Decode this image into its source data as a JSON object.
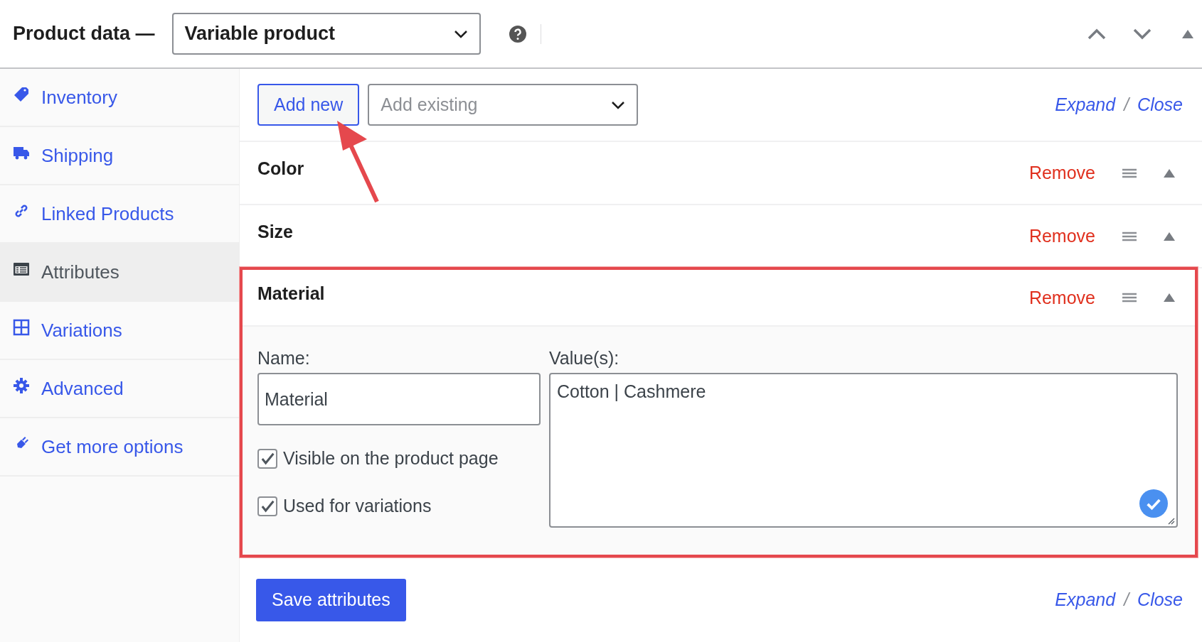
{
  "header": {
    "title": "Product data —",
    "product_type": "Variable product"
  },
  "sidebar": {
    "items": [
      {
        "label": "Inventory",
        "selected": false
      },
      {
        "label": "Shipping",
        "selected": false
      },
      {
        "label": "Linked Products",
        "selected": false
      },
      {
        "label": "Attributes",
        "selected": true
      },
      {
        "label": "Variations",
        "selected": false
      },
      {
        "label": "Advanced",
        "selected": false
      },
      {
        "label": "Get more options",
        "selected": false
      }
    ]
  },
  "toolbar": {
    "add_new": "Add new",
    "add_existing": {
      "placeholder": "Add existing"
    },
    "expand": "Expand",
    "separator": "/",
    "close": "Close"
  },
  "attributes": [
    {
      "name": "Color",
      "remove": "Remove",
      "expanded": false,
      "highlighted": false
    },
    {
      "name": "Size",
      "remove": "Remove",
      "expanded": false,
      "highlighted": false
    },
    {
      "name": "Material",
      "remove": "Remove",
      "expanded": true,
      "highlighted": true,
      "name_label": "Name:",
      "name_value": "Material",
      "values_label": "Value(s):",
      "values": "Cotton | Cashmere",
      "options": [
        {
          "label": "Visible on the product page",
          "checked": true
        },
        {
          "label": "Used for variations",
          "checked": true
        }
      ]
    }
  ],
  "footer": {
    "save": "Save attributes",
    "expand": "Expand",
    "separator": "/",
    "close": "Close"
  }
}
